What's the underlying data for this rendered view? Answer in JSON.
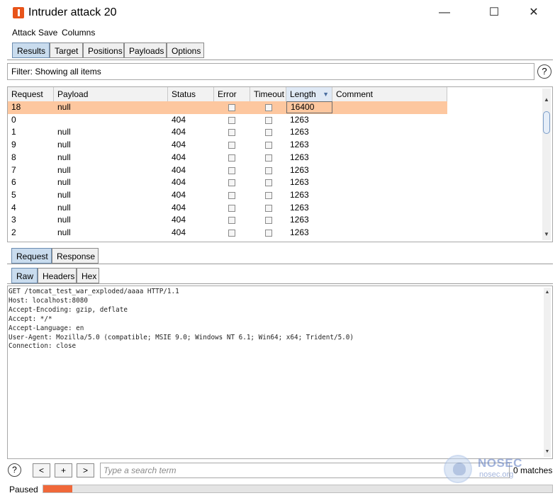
{
  "window": {
    "title": "Intruder attack 20",
    "minimize": "—",
    "maximize": "☐",
    "close": "✕"
  },
  "menu": [
    "Attack",
    "Save",
    "Columns"
  ],
  "top_tabs": [
    "Results",
    "Target",
    "Positions",
    "Payloads",
    "Options"
  ],
  "filter": {
    "text": "Filter: Showing all items",
    "help": "?"
  },
  "table": {
    "columns": [
      "Request",
      "Payload",
      "Status",
      "Error",
      "Timeout",
      "Length",
      "Comment"
    ],
    "sorted_column": "Length",
    "rows": [
      {
        "request": "18",
        "payload": "null",
        "status": "",
        "length": "16400",
        "selected": true
      },
      {
        "request": "0",
        "payload": "",
        "status": "404",
        "length": "1263"
      },
      {
        "request": "1",
        "payload": "null",
        "status": "404",
        "length": "1263"
      },
      {
        "request": "9",
        "payload": "null",
        "status": "404",
        "length": "1263"
      },
      {
        "request": "8",
        "payload": "null",
        "status": "404",
        "length": "1263"
      },
      {
        "request": "7",
        "payload": "null",
        "status": "404",
        "length": "1263"
      },
      {
        "request": "6",
        "payload": "null",
        "status": "404",
        "length": "1263"
      },
      {
        "request": "5",
        "payload": "null",
        "status": "404",
        "length": "1263"
      },
      {
        "request": "4",
        "payload": "null",
        "status": "404",
        "length": "1263"
      },
      {
        "request": "3",
        "payload": "null",
        "status": "404",
        "length": "1263"
      },
      {
        "request": "2",
        "payload": "null",
        "status": "404",
        "length": "1263"
      }
    ]
  },
  "detail_tabs": [
    "Request",
    "Response"
  ],
  "view_tabs": [
    "Raw",
    "Headers",
    "Hex"
  ],
  "raw_request": "GET /tomcat_test_war_exploded/aaaa HTTP/1.1\nHost: localhost:8080\nAccept-Encoding: gzip, deflate\nAccept: */*\nAccept-Language: en\nUser-Agent: Mozilla/5.0 (compatible; MSIE 9.0; Windows NT 6.1; Win64; x64; Trident/5.0)\nConnection: close",
  "search": {
    "help": "?",
    "prev": "<",
    "add": "+",
    "next": ">",
    "placeholder": "Type a search term",
    "matches": "0 matches"
  },
  "status": {
    "label": "Paused",
    "progress_fraction": 0.057
  },
  "watermark": {
    "brand": "NOSEC",
    "site": "nosec.org"
  },
  "colors": {
    "selected_row": "#fdc79f",
    "progress": "#f0683a",
    "active_tab": "#c9dcee",
    "app_icon": "#e8541a"
  }
}
